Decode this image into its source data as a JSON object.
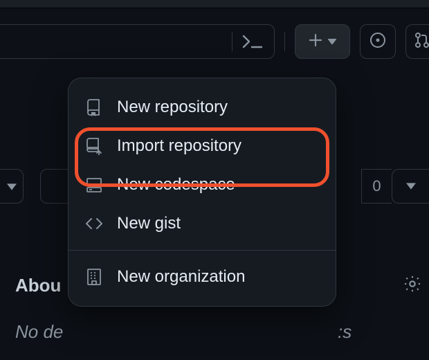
{
  "toolbar": {
    "command_palette_icon": "console-prompt-icon",
    "create_icon": "plus-icon",
    "create_caret": "caret-down-icon",
    "issues_icon": "issue-dot-icon",
    "pr_icon": "git-pull-request-icon"
  },
  "create_menu": {
    "items": [
      {
        "icon": "repo-icon",
        "label": "New repository"
      },
      {
        "icon": "repo-import-icon",
        "label": "Import repository"
      },
      {
        "icon": "codespace-icon",
        "label": "New codespace"
      },
      {
        "icon": "code-icon",
        "label": "New gist"
      }
    ],
    "items_b": [
      {
        "icon": "organization-icon",
        "label": "New organization"
      }
    ]
  },
  "background": {
    "star_count": "0",
    "about_heading": "About",
    "about_heading_visible": "Abou",
    "description_fragment": "No de",
    "description_trailing": ":s"
  },
  "colors": {
    "bg": "#0d1117",
    "surface": "#161b22",
    "border": "#30363d",
    "text": "#e6edf3",
    "muted": "#8b949e",
    "highlight": "#f0502e"
  }
}
